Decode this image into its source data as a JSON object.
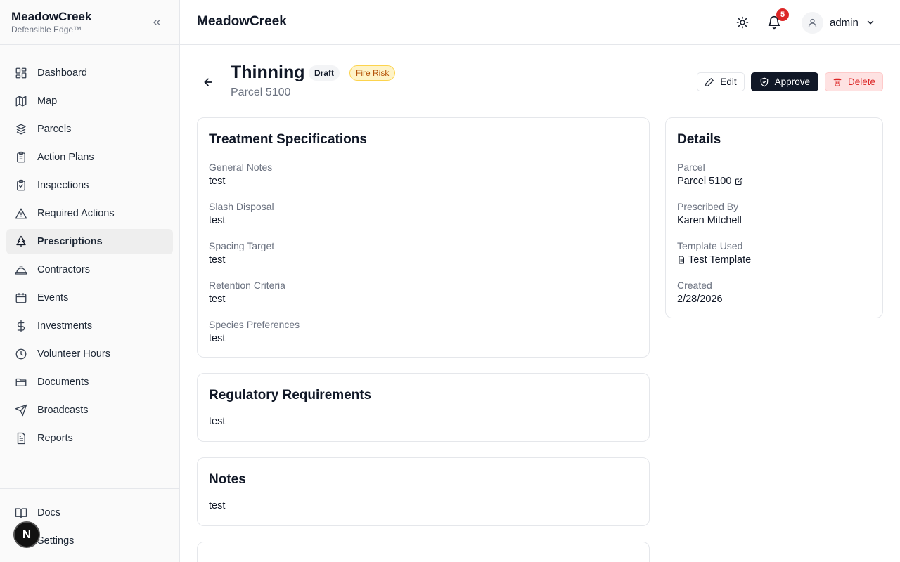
{
  "sidebar": {
    "brand_title": "MeadowCreek",
    "brand_subtitle": "Defensible Edge™",
    "items": [
      {
        "label": "Dashboard",
        "icon": "dashboard-icon"
      },
      {
        "label": "Map",
        "icon": "map-icon"
      },
      {
        "label": "Parcels",
        "icon": "parcels-icon"
      },
      {
        "label": "Action Plans",
        "icon": "clipboard-list-icon"
      },
      {
        "label": "Inspections",
        "icon": "clipboard-check-icon"
      },
      {
        "label": "Required Actions",
        "icon": "warning-triangle-icon"
      },
      {
        "label": "Prescriptions",
        "icon": "tree-icon",
        "active": true
      },
      {
        "label": "Contractors",
        "icon": "hard-hat-icon"
      },
      {
        "label": "Events",
        "icon": "calendar-icon"
      },
      {
        "label": "Investments",
        "icon": "dollar-icon"
      },
      {
        "label": "Volunteer Hours",
        "icon": "clock-icon"
      },
      {
        "label": "Documents",
        "icon": "folder-icon"
      },
      {
        "label": "Broadcasts",
        "icon": "send-icon"
      },
      {
        "label": "Reports",
        "icon": "report-icon"
      }
    ],
    "footer_items": [
      {
        "label": "Docs",
        "icon": "book-icon"
      },
      {
        "label": "Settings",
        "icon": "gear-icon"
      }
    ],
    "floating_avatar": "N"
  },
  "header": {
    "title": "MeadowCreek",
    "notification_count": "5",
    "user_name": "admin"
  },
  "page": {
    "title": "Thinning",
    "status_badge": "Draft",
    "category_badge": "Fire Risk",
    "subtitle": "Parcel 5100",
    "actions": {
      "edit": "Edit",
      "approve": "Approve",
      "delete": "Delete"
    }
  },
  "treatment": {
    "heading": "Treatment Specifications",
    "fields": [
      {
        "label": "General Notes",
        "value": "test"
      },
      {
        "label": "Slash Disposal",
        "value": "test"
      },
      {
        "label": "Spacing Target",
        "value": "test"
      },
      {
        "label": "Retention Criteria",
        "value": "test"
      },
      {
        "label": "Species Preferences",
        "value": "test"
      }
    ]
  },
  "regulatory": {
    "heading": "Regulatory Requirements",
    "value": "test"
  },
  "notes": {
    "heading": "Notes",
    "value": "test"
  },
  "details": {
    "heading": "Details",
    "parcel_label": "Parcel",
    "parcel_value": "Parcel 5100",
    "prescribed_label": "Prescribed By",
    "prescribed_value": "Karen Mitchell",
    "template_label": "Template Used",
    "template_value": "Test Template",
    "created_label": "Created",
    "created_value": "2/28/2026"
  }
}
